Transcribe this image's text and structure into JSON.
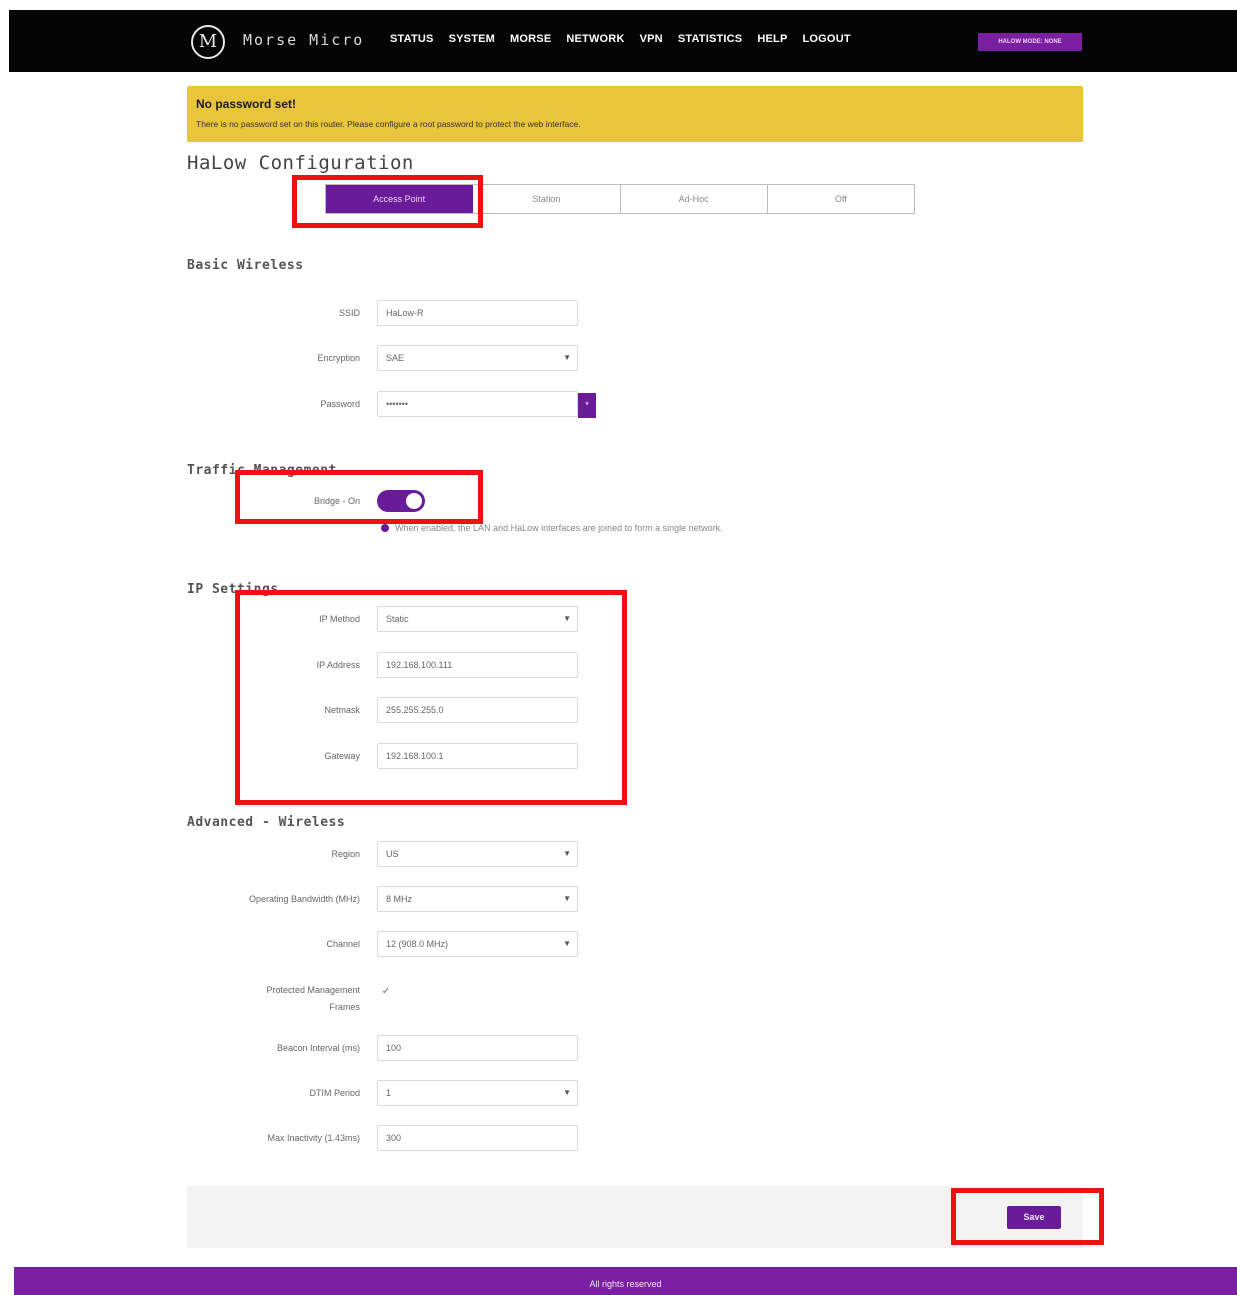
{
  "brand": {
    "logo_mark": "M",
    "logo_text": "Morse Micro"
  },
  "nav": {
    "items": [
      "STATUS",
      "SYSTEM",
      "MORSE",
      "NETWORK",
      "VPN",
      "STATISTICS",
      "HELP",
      "LOGOUT"
    ],
    "badge": "HALOW MODE: NONE"
  },
  "warning": {
    "title": "No password set!",
    "text": "There is no password set on this router. Please configure a root password to protect the web interface."
  },
  "page_title": "HaLow Configuration",
  "tabs": [
    "Access Point",
    "Station",
    "Ad-Hoc",
    "Off"
  ],
  "active_tab": "Access Point",
  "sections": {
    "basic": "Basic Wireless",
    "traffic": "Traffic Management",
    "ip": "IP Settings",
    "advanced": "Advanced - Wireless"
  },
  "basic": {
    "ssid_label": "SSID",
    "ssid_value": "HaLow-R",
    "encryption_label": "Encryption",
    "encryption_value": "SAE",
    "password_label": "Password",
    "password_value": "•••••••"
  },
  "traffic": {
    "bridge_label": "Bridge - On",
    "bridge_hint": "When enabled, the LAN and HaLow interfaces are joined to form a single network."
  },
  "ip": {
    "method_label": "IP Method",
    "method_value": "Static",
    "address_label": "IP Address",
    "address_value": "192.168.100.111",
    "netmask_label": "Netmask",
    "netmask_value": "255.255.255.0",
    "gateway_label": "Gateway",
    "gateway_value": "192.168.100.1"
  },
  "advanced": {
    "region_label": "Region",
    "region_value": "US",
    "bandwidth_label": "Operating Bandwidth (MHz)",
    "bandwidth_value": "8 MHz",
    "channel_label": "Channel",
    "channel_value": "12 (908.0 MHz)",
    "pmf_label_1": "Protected Management",
    "pmf_label_2": "Frames",
    "pmf_check": "✓",
    "beacon_label": "Beacon Interval (ms)",
    "beacon_value": "100",
    "dtim_label": "DTIM Period",
    "dtim_value": "1",
    "inactivity_label": "Max Inactivity (1.43ms)",
    "inactivity_value": "300"
  },
  "save_label": "Save",
  "footer": "All rights reserved",
  "colors": {
    "brand_purple": "#6a1b9a",
    "warning_yellow": "#e8c53a",
    "annotation_red": "#ee1111"
  }
}
